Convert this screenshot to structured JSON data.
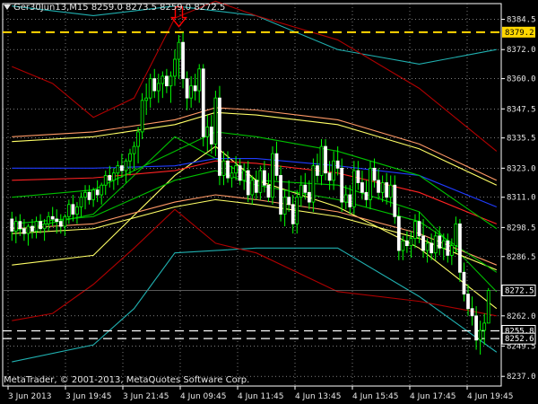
{
  "header": {
    "symbol_timeframe": "Ger30Jun13,M15",
    "ohlc": "8259.0 8273.5 8259.0 8272.5"
  },
  "footer": {
    "copyright": "MetaTrader, © 2001-2013, MetaQuotes Software Corp."
  },
  "colors": {
    "background": "#000000",
    "grid": "#c8c8c8",
    "axis": "#ffffff",
    "candle_bull": "#00ff00",
    "candle_bear": "#ffffff",
    "level_line": "#ffd700",
    "arrow": "#ff0000",
    "band_yellow": "#ffff66",
    "band_orange": "#ff9966",
    "band_red": "#ff2222",
    "band_green": "#00c000",
    "band_blue": "#1f3cff",
    "band_cyan": "#20b0b0",
    "band_darkred": "#b00000"
  },
  "chart_data": {
    "type": "candlestick",
    "y_ticks": [
      "8384.5",
      "8372.0",
      "8360.0",
      "8347.5",
      "8335.5",
      "8323.0",
      "8311.0",
      "8298.5",
      "8286.5",
      "8262.0",
      "8249.5",
      "8237.0"
    ],
    "x_ticks": [
      "3 Jun 2013",
      "3 Jun 19:45",
      "3 Jun 21:45",
      "4 Jun 09:45",
      "4 Jun 11:45",
      "4 Jun 13:45",
      "4 Jun 15:45",
      "4 Jun 17:45",
      "4 Jun 19:45"
    ],
    "ylim": [
      8233,
      8391
    ],
    "price_labels": [
      {
        "text": "8379.2",
        "value": 8379.2,
        "style": "yellow"
      },
      {
        "text": "8272.5",
        "value": 8272.5,
        "style": "white"
      },
      {
        "text": "8255.8",
        "value": 8255.8,
        "style": "white"
      },
      {
        "text": "8252.6",
        "value": 8252.6,
        "style": "white"
      }
    ],
    "dashed_levels": [
      {
        "value": 8379.2,
        "color": "#ffd700"
      },
      {
        "value": 8255.8,
        "color": "#ffffff"
      },
      {
        "value": 8252.6,
        "color": "#ffffff"
      }
    ],
    "arrow_marker": {
      "bar": 41,
      "value": 8381.5
    },
    "candles": [
      [
        8302,
        8305,
        8293,
        8297
      ],
      [
        8297,
        8303,
        8292,
        8301
      ],
      [
        8301,
        8304,
        8295,
        8298
      ],
      [
        8298,
        8302,
        8293,
        8296
      ],
      [
        8296,
        8300,
        8291,
        8299
      ],
      [
        8299,
        8302,
        8294,
        8297
      ],
      [
        8297,
        8303,
        8294,
        8301
      ],
      [
        8301,
        8304,
        8296,
        8298
      ],
      [
        8298,
        8302,
        8293,
        8300
      ],
      [
        8300,
        8305,
        8297,
        8303
      ],
      [
        8303,
        8307,
        8299,
        8302
      ],
      [
        8302,
        8306,
        8296,
        8301
      ],
      [
        8301,
        8304,
        8296,
        8299
      ],
      [
        8299,
        8304,
        8295,
        8303
      ],
      [
        8303,
        8310,
        8300,
        8308
      ],
      [
        8308,
        8312,
        8301,
        8304
      ],
      [
        8304,
        8309,
        8300,
        8307
      ],
      [
        8307,
        8313,
        8303,
        8311
      ],
      [
        8311,
        8316,
        8306,
        8313
      ],
      [
        8313,
        8316,
        8308,
        8310
      ],
      [
        8310,
        8315,
        8307,
        8314
      ],
      [
        8314,
        8318,
        8309,
        8312
      ],
      [
        8312,
        8317,
        8308,
        8316
      ],
      [
        8316,
        8322,
        8312,
        8320
      ],
      [
        8320,
        8324,
        8315,
        8318
      ],
      [
        8318,
        8323,
        8314,
        8321
      ],
      [
        8321,
        8326,
        8316,
        8324
      ],
      [
        8324,
        8329,
        8319,
        8322
      ],
      [
        8322,
        8327,
        8317,
        8326
      ],
      [
        8326,
        8331,
        8320,
        8329
      ],
      [
        8329,
        8334,
        8322,
        8332
      ],
      [
        8332,
        8340,
        8325,
        8338
      ],
      [
        8338,
        8354,
        8335,
        8351
      ],
      [
        8351,
        8358,
        8345,
        8352
      ],
      [
        8352,
        8362,
        8348,
        8360
      ],
      [
        8360,
        8364,
        8352,
        8355
      ],
      [
        8355,
        8362,
        8350,
        8358
      ],
      [
        8358,
        8363,
        8352,
        8361
      ],
      [
        8361,
        8364,
        8354,
        8357
      ],
      [
        8357,
        8363,
        8350,
        8361
      ],
      [
        8361,
        8372,
        8357,
        8368
      ],
      [
        8368,
        8378,
        8360,
        8375
      ],
      [
        8375,
        8379,
        8356,
        8360
      ],
      [
        8360,
        8363,
        8347,
        8352
      ],
      [
        8352,
        8361,
        8348,
        8357
      ],
      [
        8357,
        8362,
        8351,
        8355
      ],
      [
        8355,
        8366,
        8350,
        8364
      ],
      [
        8364,
        8366,
        8332,
        8336
      ],
      [
        8336,
        8345,
        8330,
        8340
      ],
      [
        8340,
        8345,
        8329,
        8333
      ],
      [
        8333,
        8355,
        8328,
        8352
      ],
      [
        8352,
        8357,
        8316,
        8320
      ],
      [
        8320,
        8330,
        8316,
        8326
      ],
      [
        8326,
        8330,
        8317,
        8319
      ],
      [
        8319,
        8324,
        8315,
        8321
      ],
      [
        8321,
        8328,
        8318,
        8324
      ],
      [
        8324,
        8327,
        8316,
        8318
      ],
      [
        8318,
        8325,
        8314,
        8322
      ],
      [
        8322,
        8326,
        8309,
        8312
      ],
      [
        8312,
        8320,
        8308,
        8318
      ],
      [
        8318,
        8322,
        8310,
        8313
      ],
      [
        8313,
        8324,
        8310,
        8322
      ],
      [
        8322,
        8326,
        8313,
        8316
      ],
      [
        8316,
        8321,
        8309,
        8311
      ],
      [
        8311,
        8332,
        8308,
        8329
      ],
      [
        8329,
        8334,
        8318,
        8320
      ],
      [
        8320,
        8324,
        8301,
        8304
      ],
      [
        8304,
        8314,
        8299,
        8311
      ],
      [
        8311,
        8318,
        8305,
        8308
      ],
      [
        8308,
        8312,
        8296,
        8300
      ],
      [
        8300,
        8314,
        8296,
        8311
      ],
      [
        8311,
        8320,
        8307,
        8316
      ],
      [
        8316,
        8321,
        8310,
        8313
      ],
      [
        8313,
        8318,
        8306,
        8309
      ],
      [
        8309,
        8327,
        8305,
        8324
      ],
      [
        8324,
        8329,
        8317,
        8320
      ],
      [
        8320,
        8335,
        8316,
        8332
      ],
      [
        8332,
        8335,
        8318,
        8321
      ],
      [
        8321,
        8326,
        8314,
        8318
      ],
      [
        8318,
        8330,
        8314,
        8326
      ],
      [
        8326,
        8332,
        8320,
        8323
      ],
      [
        8323,
        8327,
        8305,
        8309
      ],
      [
        8309,
        8316,
        8306,
        8312
      ],
      [
        8312,
        8316,
        8304,
        8307
      ],
      [
        8307,
        8326,
        8304,
        8322
      ],
      [
        8322,
        8326,
        8314,
        8317
      ],
      [
        8317,
        8322,
        8310,
        8313
      ],
      [
        8313,
        8318,
        8307,
        8310
      ],
      [
        8310,
        8326,
        8306,
        8323
      ],
      [
        8323,
        8327,
        8315,
        8318
      ],
      [
        8318,
        8323,
        8310,
        8313
      ],
      [
        8313,
        8320,
        8309,
        8317
      ],
      [
        8317,
        8321,
        8308,
        8311
      ],
      [
        8311,
        8320,
        8307,
        8316
      ],
      [
        8316,
        8320,
        8300,
        8303
      ],
      [
        8303,
        8307,
        8285,
        8289
      ],
      [
        8289,
        8295,
        8285,
        8293
      ],
      [
        8293,
        8297,
        8288,
        8291
      ],
      [
        8291,
        8297,
        8286,
        8294
      ],
      [
        8294,
        8304,
        8290,
        8301
      ],
      [
        8301,
        8305,
        8292,
        8295
      ],
      [
        8295,
        8302,
        8286,
        8289
      ],
      [
        8289,
        8294,
        8284,
        8292
      ],
      [
        8292,
        8296,
        8285,
        8288
      ],
      [
        8288,
        8297,
        8285,
        8295
      ],
      [
        8295,
        8299,
        8287,
        8290
      ],
      [
        8290,
        8296,
        8285,
        8293
      ],
      [
        8293,
        8296,
        8284,
        8287
      ],
      [
        8287,
        8294,
        8283,
        8291
      ],
      [
        8291,
        8303,
        8288,
        8300
      ],
      [
        8300,
        8302,
        8276,
        8280
      ],
      [
        8280,
        8284,
        8268,
        8271
      ],
      [
        8271,
        8275,
        8262,
        8265
      ],
      [
        8265,
        8270,
        8258,
        8262
      ],
      [
        8262,
        8266,
        8248,
        8252
      ],
      [
        8252,
        8260,
        8246,
        8256
      ],
      [
        8256,
        8263,
        8250,
        8259
      ],
      [
        8259,
        8273.5,
        8259,
        8272.5
      ]
    ],
    "bands": [
      {
        "color": "#00c000",
        "values": [
          [
            0,
            8297
          ],
          [
            20,
            8304
          ],
          [
            40,
            8336
          ],
          [
            60,
            8318
          ],
          [
            80,
            8316
          ],
          [
            100,
            8305
          ],
          [
            119,
            8272
          ]
        ]
      },
      {
        "color": "#ffff66",
        "values": [
          [
            0,
            8283
          ],
          [
            20,
            8287
          ],
          [
            40,
            8320
          ],
          [
            50,
            8332
          ],
          [
            60,
            8318
          ],
          [
            80,
            8307
          ],
          [
            100,
            8290
          ],
          [
            119,
            8265
          ]
        ]
      },
      {
        "color": "#ff9966",
        "values": [
          [
            0,
            8336
          ],
          [
            20,
            8338
          ],
          [
            40,
            8343
          ],
          [
            50,
            8348
          ],
          [
            60,
            8347
          ],
          [
            80,
            8343
          ],
          [
            100,
            8333
          ],
          [
            119,
            8318
          ]
        ]
      },
      {
        "color": "#ffff66",
        "values": [
          [
            0,
            8334
          ],
          [
            20,
            8336
          ],
          [
            40,
            8341
          ],
          [
            50,
            8346
          ],
          [
            60,
            8345
          ],
          [
            80,
            8341
          ],
          [
            100,
            8331
          ],
          [
            119,
            8316
          ]
        ]
      },
      {
        "color": "#ff9966",
        "values": [
          [
            0,
            8298
          ],
          [
            20,
            8300
          ],
          [
            40,
            8309
          ],
          [
            50,
            8312
          ],
          [
            60,
            8310
          ],
          [
            80,
            8305
          ],
          [
            100,
            8296
          ],
          [
            119,
            8283
          ]
        ]
      },
      {
        "color": "#ffff66",
        "values": [
          [
            0,
            8296
          ],
          [
            20,
            8298
          ],
          [
            40,
            8307
          ],
          [
            50,
            8310
          ],
          [
            60,
            8308
          ],
          [
            80,
            8303
          ],
          [
            100,
            8294
          ],
          [
            119,
            8281
          ]
        ]
      },
      {
        "color": "#ff2222",
        "values": [
          [
            0,
            8318
          ],
          [
            20,
            8319
          ],
          [
            40,
            8322
          ],
          [
            50,
            8326
          ],
          [
            60,
            8325
          ],
          [
            80,
            8321
          ],
          [
            100,
            8313
          ],
          [
            119,
            8300
          ]
        ]
      },
      {
        "color": "#1f3cff",
        "values": [
          [
            0,
            8323
          ],
          [
            20,
            8323
          ],
          [
            40,
            8324
          ],
          [
            50,
            8327
          ],
          [
            60,
            8327
          ],
          [
            80,
            8324
          ],
          [
            100,
            8320
          ],
          [
            119,
            8307
          ]
        ]
      },
      {
        "color": "#00c000",
        "values": [
          [
            0,
            8311
          ],
          [
            20,
            8314
          ],
          [
            40,
            8330
          ],
          [
            50,
            8338
          ],
          [
            60,
            8336
          ],
          [
            80,
            8330
          ],
          [
            100,
            8320
          ],
          [
            119,
            8298
          ]
        ]
      },
      {
        "color": "#00c000",
        "values": [
          [
            0,
            8300
          ],
          [
            20,
            8303
          ],
          [
            40,
            8318
          ],
          [
            50,
            8322
          ],
          [
            60,
            8316
          ],
          [
            80,
            8310
          ],
          [
            100,
            8301
          ],
          [
            119,
            8280
          ]
        ]
      },
      {
        "color": "#20b0b0",
        "values": [
          [
            0,
            8243
          ],
          [
            20,
            8250
          ],
          [
            30,
            8265
          ],
          [
            40,
            8288
          ],
          [
            60,
            8290
          ],
          [
            80,
            8290
          ],
          [
            100,
            8270
          ],
          [
            119,
            8247
          ]
        ]
      },
      {
        "color": "#20b0b0",
        "values": [
          [
            0,
            8390
          ],
          [
            20,
            8386
          ],
          [
            40,
            8390
          ],
          [
            60,
            8386
          ],
          [
            80,
            8372
          ],
          [
            100,
            8366
          ],
          [
            119,
            8372
          ]
        ]
      },
      {
        "color": "#b00000",
        "values": [
          [
            0,
            8260
          ],
          [
            10,
            8263
          ],
          [
            20,
            8275
          ],
          [
            30,
            8290
          ],
          [
            40,
            8306
          ],
          [
            50,
            8292
          ],
          [
            60,
            8288
          ],
          [
            80,
            8272
          ],
          [
            100,
            8268
          ],
          [
            119,
            8262
          ]
        ]
      },
      {
        "color": "#b00000",
        "values": [
          [
            0,
            8365
          ],
          [
            10,
            8358
          ],
          [
            20,
            8344
          ],
          [
            30,
            8352
          ],
          [
            40,
            8385
          ],
          [
            50,
            8392
          ],
          [
            60,
            8386
          ],
          [
            80,
            8376
          ],
          [
            100,
            8356
          ],
          [
            119,
            8330
          ]
        ]
      }
    ]
  }
}
